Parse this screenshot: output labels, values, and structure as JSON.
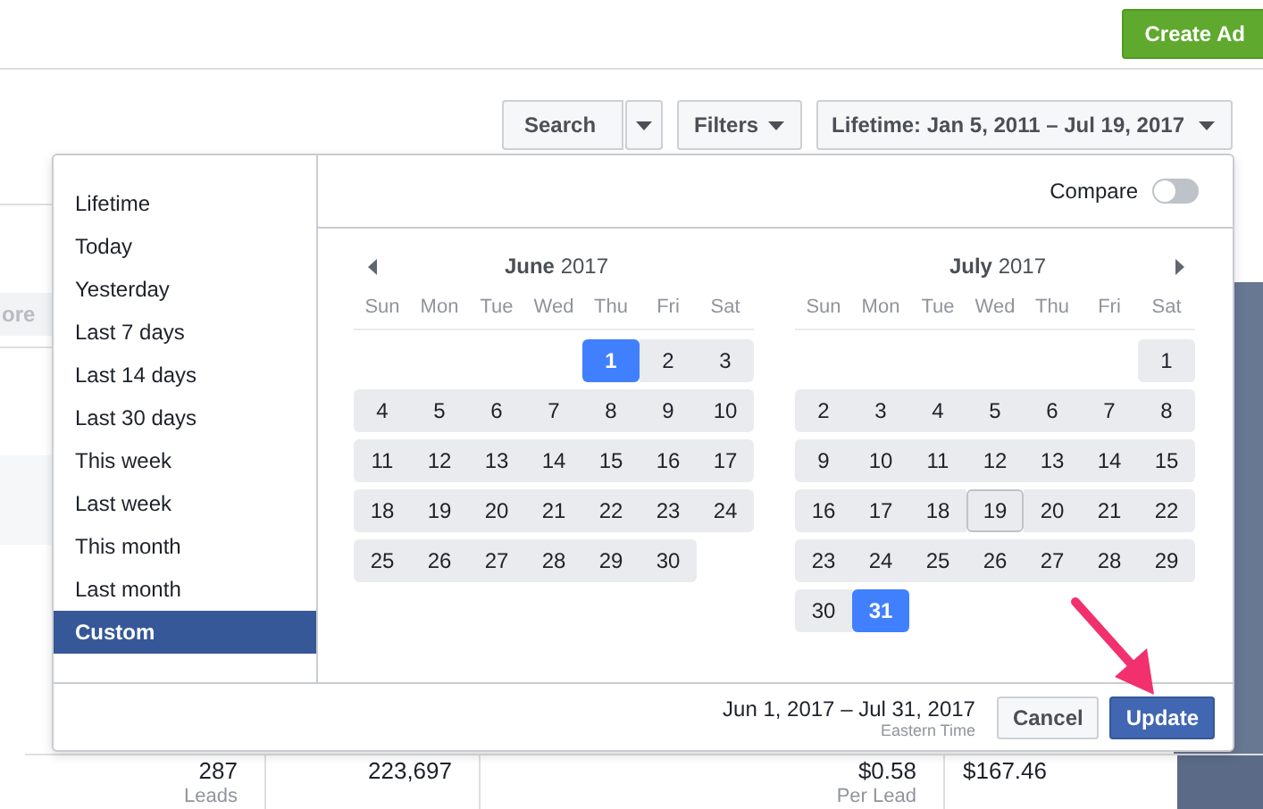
{
  "header": {
    "create_button": "Create Ad"
  },
  "toolbar": {
    "search_button": "Search",
    "filters_button": "Filters",
    "date_button": "Lifetime: Jan 5, 2011 – Jul 19, 2017"
  },
  "background": {
    "more_label": "ore",
    "stats": [
      {
        "value": "287",
        "caption": "Leads"
      },
      {
        "value": "223,697"
      },
      {
        "value": "$0.58",
        "caption": "Per Lead"
      },
      {
        "value": "$167.46"
      }
    ]
  },
  "date_picker": {
    "presets": [
      {
        "label": "Lifetime",
        "selected": false
      },
      {
        "label": "Today",
        "selected": false
      },
      {
        "label": "Yesterday",
        "selected": false
      },
      {
        "label": "Last 7 days",
        "selected": false
      },
      {
        "label": "Last 14 days",
        "selected": false
      },
      {
        "label": "Last 30 days",
        "selected": false
      },
      {
        "label": "This week",
        "selected": false
      },
      {
        "label": "Last week",
        "selected": false
      },
      {
        "label": "This month",
        "selected": false
      },
      {
        "label": "Last month",
        "selected": false
      },
      {
        "label": "Custom",
        "selected": true
      }
    ],
    "compare": {
      "label": "Compare",
      "on": false
    },
    "months": [
      {
        "month": "June",
        "year": "2017",
        "weekdays": [
          "Sun",
          "Mon",
          "Tue",
          "Wed",
          "Thu",
          "Fri",
          "Sat"
        ],
        "weeks": [
          [
            {
              "kind": "blank"
            },
            {
              "kind": "blank"
            },
            {
              "kind": "blank"
            },
            {
              "kind": "blank"
            },
            {
              "day": "1",
              "selected": true,
              "today": false
            },
            {
              "day": "2",
              "selected": false,
              "today": false
            },
            {
              "day": "3",
              "selected": false,
              "today": false
            }
          ],
          [
            {
              "day": "4",
              "selected": false,
              "today": false
            },
            {
              "day": "5",
              "selected": false,
              "today": false
            },
            {
              "day": "6",
              "selected": false,
              "today": false
            },
            {
              "day": "7",
              "selected": false,
              "today": false
            },
            {
              "day": "8",
              "selected": false,
              "today": false
            },
            {
              "day": "9",
              "selected": false,
              "today": false
            },
            {
              "day": "10",
              "selected": false,
              "today": false
            }
          ],
          [
            {
              "day": "11",
              "selected": false,
              "today": false
            },
            {
              "day": "12",
              "selected": false,
              "today": false
            },
            {
              "day": "13",
              "selected": false,
              "today": false
            },
            {
              "day": "14",
              "selected": false,
              "today": false
            },
            {
              "day": "15",
              "selected": false,
              "today": false
            },
            {
              "day": "16",
              "selected": false,
              "today": false
            },
            {
              "day": "17",
              "selected": false,
              "today": false
            }
          ],
          [
            {
              "day": "18",
              "selected": false,
              "today": false
            },
            {
              "day": "19",
              "selected": false,
              "today": false
            },
            {
              "day": "20",
              "selected": false,
              "today": false
            },
            {
              "day": "21",
              "selected": false,
              "today": false
            },
            {
              "day": "22",
              "selected": false,
              "today": false
            },
            {
              "day": "23",
              "selected": false,
              "today": false
            },
            {
              "day": "24",
              "selected": false,
              "today": false
            }
          ],
          [
            {
              "day": "25",
              "selected": false,
              "today": false
            },
            {
              "day": "26",
              "selected": false,
              "today": false
            },
            {
              "day": "27",
              "selected": false,
              "today": false
            },
            {
              "day": "28",
              "selected": false,
              "today": false
            },
            {
              "day": "29",
              "selected": false,
              "today": false
            },
            {
              "day": "30",
              "selected": false,
              "today": false
            }
          ]
        ]
      },
      {
        "month": "July",
        "year": "2017",
        "weekdays": [
          "Sun",
          "Mon",
          "Tue",
          "Wed",
          "Thu",
          "Fri",
          "Sat"
        ],
        "weeks": [
          [
            {
              "kind": "blank"
            },
            {
              "kind": "blank"
            },
            {
              "kind": "blank"
            },
            {
              "kind": "blank"
            },
            {
              "kind": "blank"
            },
            {
              "kind": "blank"
            },
            {
              "day": "1",
              "selected": false,
              "today": false
            }
          ],
          [
            {
              "day": "2",
              "selected": false,
              "today": false
            },
            {
              "day": "3",
              "selected": false,
              "today": false
            },
            {
              "day": "4",
              "selected": false,
              "today": false
            },
            {
              "day": "5",
              "selected": false,
              "today": false
            },
            {
              "day": "6",
              "selected": false,
              "today": false
            },
            {
              "day": "7",
              "selected": false,
              "today": false
            },
            {
              "day": "8",
              "selected": false,
              "today": false
            }
          ],
          [
            {
              "day": "9",
              "selected": false,
              "today": false
            },
            {
              "day": "10",
              "selected": false,
              "today": false
            },
            {
              "day": "11",
              "selected": false,
              "today": false
            },
            {
              "day": "12",
              "selected": false,
              "today": false
            },
            {
              "day": "13",
              "selected": false,
              "today": false
            },
            {
              "day": "14",
              "selected": false,
              "today": false
            },
            {
              "day": "15",
              "selected": false,
              "today": false
            }
          ],
          [
            {
              "day": "16",
              "selected": false,
              "today": false
            },
            {
              "day": "17",
              "selected": false,
              "today": false
            },
            {
              "day": "18",
              "selected": false,
              "today": false
            },
            {
              "day": "19",
              "selected": false,
              "today": true
            },
            {
              "day": "20",
              "selected": false,
              "today": false
            },
            {
              "day": "21",
              "selected": false,
              "today": false
            },
            {
              "day": "22",
              "selected": false,
              "today": false
            }
          ],
          [
            {
              "day": "23",
              "selected": false,
              "today": false
            },
            {
              "day": "24",
              "selected": false,
              "today": false
            },
            {
              "day": "25",
              "selected": false,
              "today": false
            },
            {
              "day": "26",
              "selected": false,
              "today": false
            },
            {
              "day": "27",
              "selected": false,
              "today": false
            },
            {
              "day": "28",
              "selected": false,
              "today": false
            },
            {
              "day": "29",
              "selected": false,
              "today": false
            }
          ],
          [
            {
              "day": "30",
              "selected": false,
              "today": false
            },
            {
              "day": "31",
              "selected": true,
              "today": false
            }
          ]
        ]
      }
    ],
    "range_label": "Jun 1, 2017 – Jul 31, 2017",
    "timezone": "Eastern Time",
    "buttons": [
      {
        "label": "Cancel",
        "kind": "secondary"
      },
      {
        "label": "Update",
        "kind": "primary"
      }
    ]
  }
}
